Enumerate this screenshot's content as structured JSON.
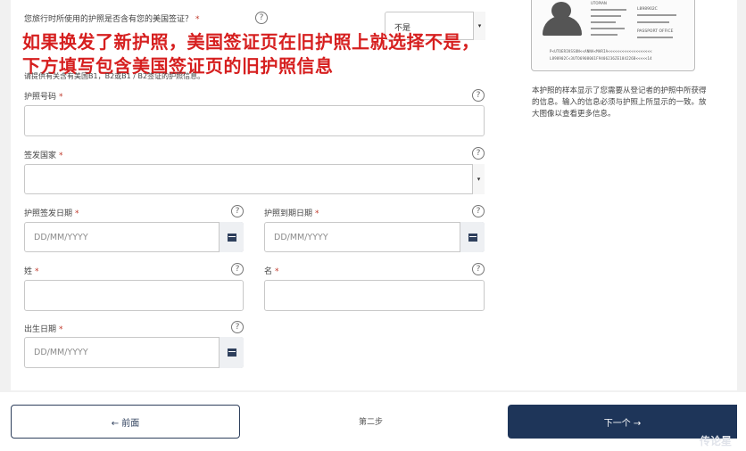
{
  "question": {
    "label": "您旅行时所使用的护照是否含有您的美国签证？",
    "required_mark": "*",
    "select_value": "不是"
  },
  "overlay": {
    "line1": "如果换发了新护照，美国签证页在旧护照上就选择不是，",
    "line2": "下方填写包含美国签证页的旧护照信息"
  },
  "instruction": "请提供有关含有美国B1，B2或B1 / B2签证的护照信息。",
  "fields": {
    "passport_number": {
      "label": "护照号码",
      "req": "*"
    },
    "issuing_country": {
      "label": "签发国家",
      "req": "*"
    },
    "issue_date": {
      "label": "护照签发日期",
      "req": "*",
      "placeholder": "DD/MM/YYYY"
    },
    "expiry_date": {
      "label": "护照到期日期",
      "req": "*",
      "placeholder": "DD/MM/YYYY"
    },
    "surname": {
      "label": "姓",
      "req": "*"
    },
    "given_name": {
      "label": "名",
      "req": "*"
    },
    "birth_date": {
      "label": "出生日期",
      "req": "*",
      "placeholder": "DD/MM/YYYY"
    }
  },
  "help_glyph": "?",
  "passport_sample": {
    "mrz1": "P<UTOERIKSSON<<ANNA<MARIA<<<<<<<<<<<<<<<<<<<",
    "mrz2": "L898902C<3UTO6908061F9406236ZE184226B<<<<<14",
    "header": "UTOPIAN",
    "issuer": "PASSPORT OFFICE",
    "number": "L898902C"
  },
  "side_note": "本护照的样本显示了您需要从登记者的护照中所获得的信息。输入的信息必须与护照上所显示的一致。放大图像以查看更多信息。",
  "nav": {
    "prev_label": "← 前面",
    "step_label": "第二步",
    "next_label": "下一个 →"
  },
  "watermark": "传论星"
}
